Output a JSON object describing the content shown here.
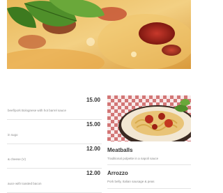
{
  "hero": {
    "image_name": "pizza-hero-image"
  },
  "menu": {
    "items": [
      {
        "price": "15.00",
        "description": "beef/pork Bolognese with hot barrel sauce"
      },
      {
        "price": "15.00",
        "description": "in sugo"
      },
      {
        "price": "12.00",
        "description": "& cheese (V)"
      },
      {
        "price": "12.00",
        "description": "auce with toasted bacon"
      }
    ]
  },
  "featured": {
    "image_name": "spaghetti-image",
    "dishes": [
      {
        "name": "Meatballs",
        "description": "Traditional polpette in a napoli sauce"
      },
      {
        "name": "Arrozzo",
        "description": "Pork belly, Italian sausage & peas"
      }
    ]
  }
}
